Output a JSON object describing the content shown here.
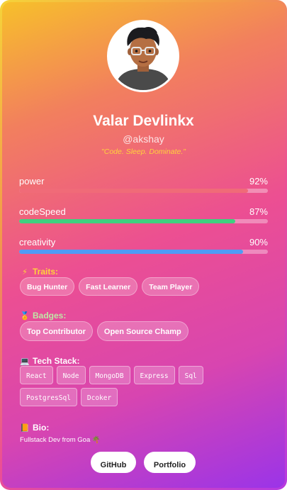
{
  "profile": {
    "name": "Valar Devlinkx",
    "handle": "@akshay",
    "tagline": "\"Code. Sleep. Dominate.\""
  },
  "stats": [
    {
      "label": "power",
      "value_text": "92%",
      "value": 92,
      "color": "#f06b78"
    },
    {
      "label": "codeSpeed",
      "value_text": "87%",
      "value": 87,
      "color": "#3fd17f"
    },
    {
      "label": "creativity",
      "value_text": "90%",
      "value": 90,
      "color": "#4f9bf5"
    }
  ],
  "traits": {
    "title": "Traits:",
    "icon": "lightning-icon",
    "color": "#ffd23c",
    "items": [
      "Bug Hunter",
      "Fast Learner",
      "Team Player"
    ]
  },
  "badges": {
    "title": "Badges:",
    "icon": "medal-icon",
    "color": "#bfe7a6",
    "items": [
      "Top Contributor",
      "Open Source Champ"
    ]
  },
  "tech_stack": {
    "title": "Tech Stack:",
    "icon": "laptop-icon",
    "color": "#ffffff",
    "items": [
      "React",
      "Node",
      "MongoDB",
      "Express",
      "Sql",
      "PostgresSql",
      "Dcoker"
    ]
  },
  "bio": {
    "title": "Bio:",
    "icon": "memo-icon",
    "color": "#ffffff",
    "text": "Fullstack Dev from Goa 🌴"
  },
  "buttons": {
    "github": "GitHub",
    "portfolio": "Portfolio"
  }
}
